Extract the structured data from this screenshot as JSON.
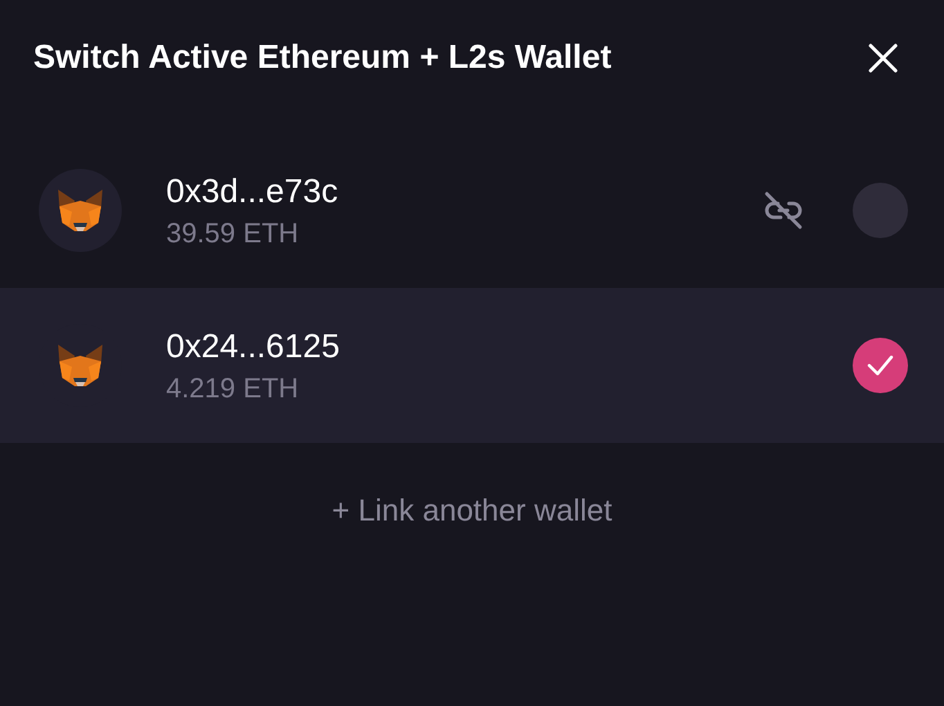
{
  "dialog": {
    "title": "Switch Active Ethereum + L2s Wallet"
  },
  "wallets": [
    {
      "address": "0x3d...e73c",
      "balance": "39.59 ETH",
      "selected": false
    },
    {
      "address": "0x24...6125",
      "balance": "4.219 ETH",
      "selected": true
    }
  ],
  "link_action": "+ Link another wallet"
}
